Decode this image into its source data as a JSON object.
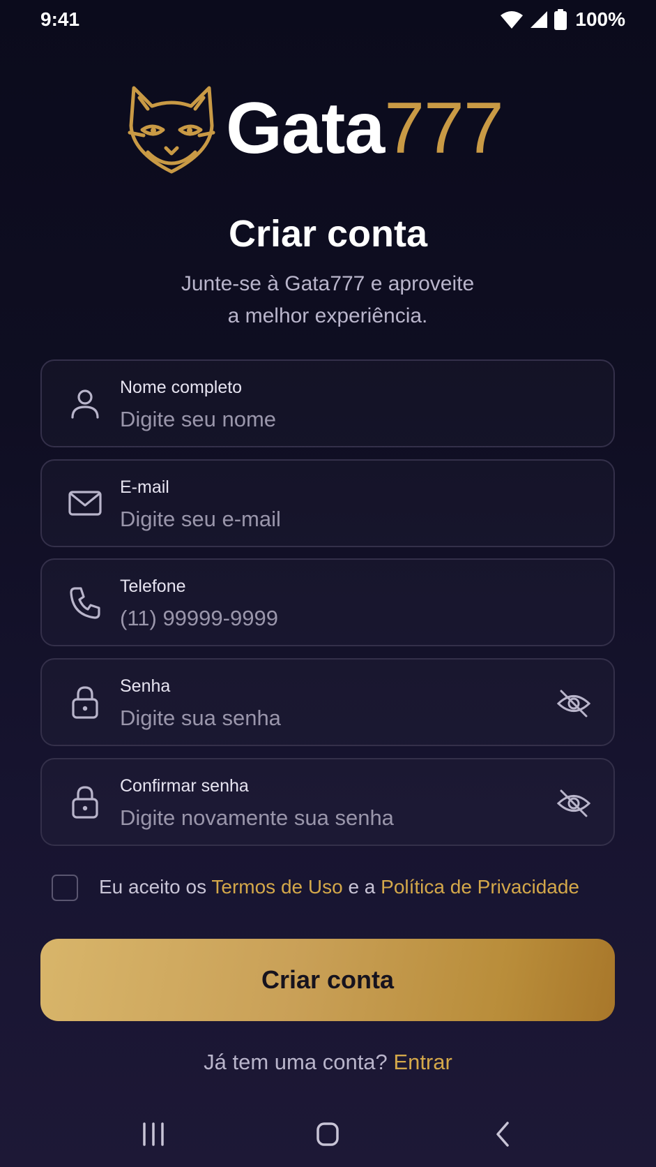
{
  "status_bar": {
    "time": "9:41",
    "battery": "100%"
  },
  "brand": {
    "word": "Gata",
    "number": "777",
    "gold_color": "#c99a45"
  },
  "header": {
    "title": "Criar conta",
    "subtitle_line1": "Junte-se à Gata777 e aproveite",
    "subtitle_line2": "a melhor experiência."
  },
  "form": {
    "fields": [
      {
        "label": "Nome completo",
        "placeholder": "Digite seu nome",
        "icon": "user-icon"
      },
      {
        "label": "E-mail",
        "placeholder": "Digite seu e-mail",
        "icon": "mail-icon"
      },
      {
        "label": "Telefone",
        "placeholder": "(11) 99999-9999",
        "icon": "phone-icon"
      },
      {
        "label": "Senha",
        "placeholder": "Digite sua senha",
        "icon": "lock-icon",
        "toggle_icon": "eye-off-icon"
      },
      {
        "label": "Confirmar senha",
        "placeholder": "Digite novamente sua senha",
        "icon": "lock-icon",
        "toggle_icon": "eye-off-icon"
      }
    ],
    "terms": {
      "checked": false,
      "prefix": "Eu aceito os ",
      "terms_link": "Termos de Uso",
      "middle": " e a ",
      "privacy_link": "Política de Privacidade"
    },
    "submit_label": "Criar conta"
  },
  "footer": {
    "prompt": "Já tem uma conta? ",
    "login_link": "Entrar"
  },
  "colors": {
    "accent_gold": "#d4a84a",
    "background_top": "#0b0b1c",
    "background_bottom": "#1d1836",
    "field_border": "#34304a"
  },
  "nav_bar": {
    "icons": [
      "recent-apps-icon",
      "home-icon",
      "back-icon"
    ]
  }
}
